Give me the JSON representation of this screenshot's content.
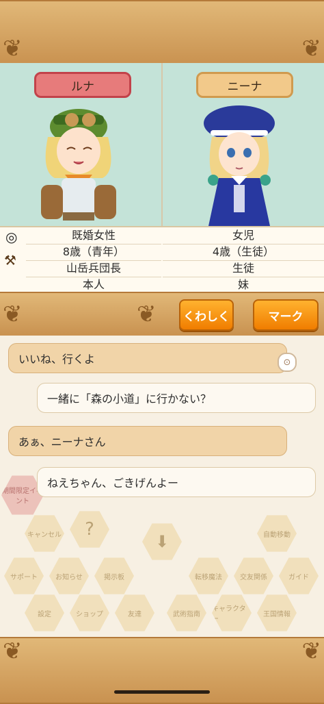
{
  "characters": {
    "left": {
      "name": "ルナ",
      "info": [
        "既婚女性",
        "8歳（青年）",
        "山岳兵団長",
        "本人"
      ]
    },
    "right": {
      "name": "ニーナ",
      "info": [
        "女児",
        "4歳（生徒）",
        "生徒",
        "妹"
      ]
    }
  },
  "actions": {
    "details_label": "くわしく",
    "mark_label": "マーク"
  },
  "chat": [
    {
      "text": "いいね、行くよ",
      "side": "left"
    },
    {
      "text": "一緒に「森の小道」に行かない？",
      "side": "right"
    },
    {
      "text": "あぁ、ニーナさん",
      "side": "left"
    },
    {
      "text": "ねえちゃん、ごきげんよー",
      "side": "right"
    }
  ],
  "bg_menu": {
    "event_label": "期間限定イベント",
    "items": [
      "キャンセル",
      "サポート",
      "お知らせ",
      "掲示板",
      "転移魔法",
      "交友関係",
      "ガイド",
      "設定",
      "ショップ",
      "友達",
      "武術指南",
      "キャラクター",
      "王国情報",
      "自動移動"
    ]
  },
  "colors": {
    "accent": "#f08a00",
    "left_badge": "#e77b7b",
    "right_badge": "#f2c98a",
    "panel_bg": "#c4e3d8"
  }
}
